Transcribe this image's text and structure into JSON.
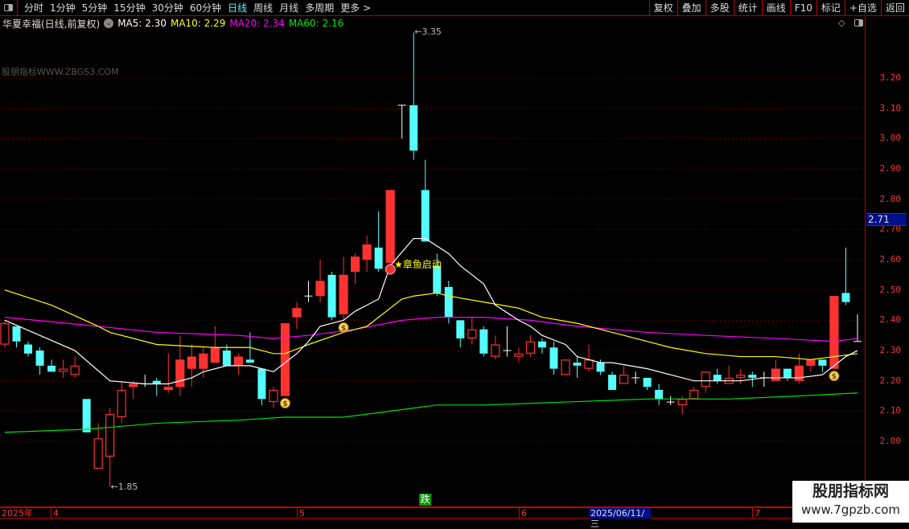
{
  "toolbar": {
    "periods": [
      "分时",
      "1分钟",
      "5分钟",
      "15分钟",
      "30分钟",
      "60分钟",
      "日线",
      "周线",
      "月线",
      "多周期",
      "更多 >"
    ],
    "active_period": "日线",
    "buttons": [
      "复权",
      "叠加",
      "多股",
      "统计",
      "画线",
      "F10",
      "标记",
      "+自选",
      "返回"
    ]
  },
  "info": {
    "title": "华夏幸福(日线,前复权)",
    "ma5": "MA5: 2.30",
    "ma10": "MA10: 2.29",
    "ma20": "MA20: 2.34",
    "ma60": "MA60: 2.16"
  },
  "colors": {
    "up": "#ff3232",
    "down": "#54ffff",
    "ma5": "#ffffff",
    "ma10": "#ffff00",
    "ma20": "#ff00ff",
    "ma60": "#00e000",
    "grid": "#8a0000"
  },
  "watermark_top": "股朋指标WWW.ZBGS3.COM",
  "axis": {
    "labels": [
      "3.20",
      "3.10",
      "3.00",
      "2.90",
      "2.80",
      "2.70",
      "2.60",
      "2.50",
      "2.40",
      "2.30",
      "2.20",
      "2.10",
      "2.00"
    ],
    "current_price": "2.71"
  },
  "annotations": {
    "high": "3.35",
    "low": "1.85",
    "signal": "★章鱼启动",
    "fall_badge": "跌"
  },
  "dates": {
    "year": "2025年",
    "m4": "4",
    "m5": "5",
    "m6": "6",
    "m7": "7",
    "selected": "2025/06/11/三"
  },
  "site_watermark": {
    "title": "股朋指标网",
    "url": "www.7gpzb.com"
  },
  "chart_data": {
    "type": "candlestick",
    "ylim": [
      1.8,
      3.4
    ],
    "ohlc": [
      [
        2.32,
        2.4,
        2.31,
        2.39
      ],
      [
        2.38,
        2.38,
        2.31,
        2.33
      ],
      [
        2.32,
        2.33,
        2.28,
        2.29
      ],
      [
        2.3,
        2.31,
        2.22,
        2.25
      ],
      [
        2.25,
        2.27,
        2.23,
        2.23
      ],
      [
        2.23,
        2.27,
        2.21,
        2.24
      ],
      [
        2.22,
        2.28,
        2.21,
        2.25
      ],
      [
        2.14,
        2.14,
        2.03,
        2.03
      ],
      [
        1.91,
        2.06,
        1.91,
        2.01
      ],
      [
        1.95,
        2.11,
        1.85,
        2.09
      ],
      [
        2.08,
        2.2,
        2.06,
        2.17
      ],
      [
        2.18,
        2.2,
        2.14,
        2.19
      ],
      [
        2.19,
        2.22,
        2.18,
        2.19
      ],
      [
        2.2,
        2.21,
        2.15,
        2.19
      ],
      [
        2.17,
        2.29,
        2.16,
        2.18
      ],
      [
        2.18,
        2.35,
        2.15,
        2.27
      ],
      [
        2.24,
        2.32,
        2.18,
        2.28
      ],
      [
        2.24,
        2.31,
        2.21,
        2.29
      ],
      [
        2.26,
        2.38,
        2.26,
        2.31
      ],
      [
        2.3,
        2.32,
        2.25,
        2.25
      ],
      [
        2.25,
        2.29,
        2.22,
        2.28
      ],
      [
        2.27,
        2.36,
        2.26,
        2.26
      ],
      [
        2.24,
        2.24,
        2.12,
        2.14
      ],
      [
        2.13,
        2.18,
        2.11,
        2.17
      ],
      [
        2.15,
        2.39,
        2.15,
        2.39
      ],
      [
        2.41,
        2.46,
        2.37,
        2.44
      ],
      [
        2.48,
        2.53,
        2.46,
        2.48
      ],
      [
        2.48,
        2.6,
        2.46,
        2.53
      ],
      [
        2.55,
        2.56,
        2.4,
        2.41
      ],
      [
        2.42,
        2.61,
        2.4,
        2.55
      ],
      [
        2.56,
        2.62,
        2.52,
        2.61
      ],
      [
        2.6,
        2.68,
        2.56,
        2.65
      ],
      [
        2.64,
        2.76,
        2.56,
        2.57
      ],
      [
        2.59,
        2.83,
        2.58,
        2.83
      ],
      [
        3.11,
        3.11,
        3.0,
        3.11
      ],
      [
        3.11,
        3.35,
        2.93,
        2.96
      ],
      [
        2.83,
        2.93,
        2.66,
        2.66
      ],
      [
        2.58,
        2.62,
        2.48,
        2.49
      ],
      [
        2.51,
        2.53,
        2.39,
        2.41
      ],
      [
        2.4,
        2.4,
        2.31,
        2.34
      ],
      [
        2.34,
        2.41,
        2.32,
        2.37
      ],
      [
        2.37,
        2.38,
        2.28,
        2.29
      ],
      [
        2.28,
        2.35,
        2.27,
        2.32
      ],
      [
        2.3,
        2.38,
        2.28,
        2.3
      ],
      [
        2.28,
        2.31,
        2.26,
        2.29
      ],
      [
        2.29,
        2.35,
        2.28,
        2.33
      ],
      [
        2.33,
        2.34,
        2.29,
        2.31
      ],
      [
        2.31,
        2.33,
        2.22,
        2.24
      ],
      [
        2.22,
        2.27,
        2.22,
        2.27
      ],
      [
        2.26,
        2.28,
        2.21,
        2.25
      ],
      [
        2.24,
        2.32,
        2.23,
        2.27
      ],
      [
        2.26,
        2.27,
        2.22,
        2.23
      ],
      [
        2.22,
        2.23,
        2.17,
        2.17
      ],
      [
        2.19,
        2.25,
        2.19,
        2.22
      ],
      [
        2.21,
        2.23,
        2.19,
        2.21
      ],
      [
        2.21,
        2.21,
        2.17,
        2.18
      ],
      [
        2.17,
        2.19,
        2.12,
        2.14
      ],
      [
        2.13,
        2.15,
        2.12,
        2.13
      ],
      [
        2.12,
        2.15,
        2.09,
        2.14
      ],
      [
        2.14,
        2.18,
        2.14,
        2.17
      ],
      [
        2.18,
        2.23,
        2.16,
        2.23
      ],
      [
        2.22,
        2.24,
        2.19,
        2.2
      ],
      [
        2.19,
        2.25,
        2.19,
        2.21
      ],
      [
        2.21,
        2.24,
        2.19,
        2.22
      ],
      [
        2.22,
        2.23,
        2.18,
        2.21
      ],
      [
        2.21,
        2.23,
        2.18,
        2.21
      ],
      [
        2.2,
        2.27,
        2.2,
        2.24
      ],
      [
        2.24,
        2.24,
        2.2,
        2.21
      ],
      [
        2.2,
        2.29,
        2.19,
        2.25
      ],
      [
        2.25,
        2.27,
        2.23,
        2.27
      ],
      [
        2.27,
        2.27,
        2.23,
        2.25
      ],
      [
        2.24,
        2.48,
        2.24,
        2.48
      ],
      [
        2.49,
        2.64,
        2.45,
        2.46
      ],
      [
        2.33,
        2.42,
        2.33,
        2.33
      ]
    ],
    "filled_up": [
      11,
      14,
      15,
      16,
      17,
      18,
      20,
      24,
      25,
      27,
      29,
      30,
      31,
      33,
      66,
      68,
      69,
      71
    ],
    "ma": {
      "ma5": [
        [
          0,
          2.4
        ],
        [
          3,
          2.35
        ],
        [
          6,
          2.3
        ],
        [
          9,
          2.2
        ],
        [
          12,
          2.19
        ],
        [
          14,
          2.19
        ],
        [
          16,
          2.21
        ],
        [
          17,
          2.23
        ],
        [
          19,
          2.25
        ],
        [
          21,
          2.25
        ],
        [
          22,
          2.24
        ],
        [
          23,
          2.23
        ],
        [
          25,
          2.29
        ],
        [
          26,
          2.33
        ],
        [
          27,
          2.38
        ],
        [
          29,
          2.4
        ],
        [
          30,
          2.43
        ],
        [
          32,
          2.47
        ],
        [
          33,
          2.58
        ],
        [
          35,
          2.67
        ],
        [
          36,
          2.67
        ],
        [
          38,
          2.62
        ],
        [
          39,
          2.58
        ],
        [
          41,
          2.52
        ],
        [
          42,
          2.45
        ],
        [
          44,
          2.4
        ],
        [
          45,
          2.38
        ],
        [
          46,
          2.35
        ],
        [
          48,
          2.32
        ],
        [
          49,
          2.28
        ],
        [
          51,
          2.26
        ],
        [
          52,
          2.26
        ],
        [
          55,
          2.24
        ],
        [
          57,
          2.22
        ],
        [
          59,
          2.2
        ],
        [
          63,
          2.2
        ],
        [
          65,
          2.21
        ],
        [
          68,
          2.21
        ],
        [
          70,
          2.22
        ],
        [
          71,
          2.25
        ],
        [
          72,
          2.28
        ],
        [
          73,
          2.3
        ]
      ],
      "ma10": [
        [
          0,
          2.5
        ],
        [
          4,
          2.45
        ],
        [
          8,
          2.38
        ],
        [
          9,
          2.36
        ],
        [
          13,
          2.32
        ],
        [
          18,
          2.31
        ],
        [
          21,
          2.31
        ],
        [
          23,
          2.29
        ],
        [
          24,
          2.29
        ],
        [
          26,
          2.32
        ],
        [
          29,
          2.36
        ],
        [
          31,
          2.38
        ],
        [
          33,
          2.44
        ],
        [
          34,
          2.47
        ],
        [
          35,
          2.48
        ],
        [
          37,
          2.49
        ],
        [
          38,
          2.48
        ],
        [
          41,
          2.46
        ],
        [
          44,
          2.44
        ],
        [
          46,
          2.41
        ],
        [
          49,
          2.39
        ],
        [
          52,
          2.36
        ],
        [
          55,
          2.33
        ],
        [
          57,
          2.31
        ],
        [
          60,
          2.29
        ],
        [
          63,
          2.28
        ],
        [
          66,
          2.28
        ],
        [
          69,
          2.27
        ],
        [
          71,
          2.28
        ],
        [
          73,
          2.29
        ]
      ],
      "ma20": [
        [
          0,
          2.41
        ],
        [
          8,
          2.38
        ],
        [
          13,
          2.36
        ],
        [
          20,
          2.35
        ],
        [
          23,
          2.34
        ],
        [
          26,
          2.35
        ],
        [
          30,
          2.37
        ],
        [
          34,
          2.4
        ],
        [
          37,
          2.41
        ],
        [
          41,
          2.41
        ],
        [
          45,
          2.4
        ],
        [
          49,
          2.38
        ],
        [
          55,
          2.36
        ],
        [
          60,
          2.35
        ],
        [
          66,
          2.34
        ],
        [
          71,
          2.33
        ],
        [
          73,
          2.34
        ]
      ],
      "ma60": [
        [
          0,
          2.03
        ],
        [
          7,
          2.04
        ],
        [
          13,
          2.06
        ],
        [
          20,
          2.07
        ],
        [
          24,
          2.08
        ],
        [
          29,
          2.08
        ],
        [
          33,
          2.1
        ],
        [
          37,
          2.12
        ],
        [
          41,
          2.12
        ],
        [
          48,
          2.13
        ],
        [
          55,
          2.14
        ],
        [
          62,
          2.14
        ],
        [
          68,
          2.15
        ],
        [
          73,
          2.16
        ]
      ]
    },
    "money_bag_markers": [
      24,
      29,
      71
    ],
    "signal_marker_index": 33
  }
}
